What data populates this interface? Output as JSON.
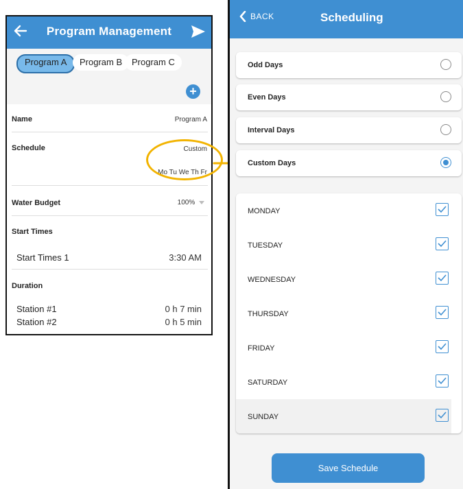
{
  "left": {
    "title": "Program Management",
    "tabs": [
      "Program A",
      "Program B",
      "Program C"
    ],
    "name_label": "Name",
    "name_value": "Program A",
    "schedule_label": "Schedule",
    "schedule_type": "Custom",
    "schedule_days": "Mo Tu We Th Fr",
    "water_budget_label": "Water Budget",
    "water_budget_value": "100%",
    "start_times_label": "Start Times",
    "start_time_1_label": "Start Times 1",
    "start_time_1_value": "3:30 AM",
    "duration_label": "Duration",
    "stations": [
      {
        "label": "Station #1",
        "value": "0 h 7 min"
      },
      {
        "label": "Station #2",
        "value": "0 h 5 min"
      }
    ]
  },
  "right": {
    "back_label": "BACK",
    "title": "Scheduling",
    "options": [
      {
        "label": "Odd Days",
        "selected": false
      },
      {
        "label": "Even Days",
        "selected": false
      },
      {
        "label": "Interval Days",
        "selected": false
      },
      {
        "label": "Custom Days",
        "selected": true
      }
    ],
    "days": [
      {
        "label": "MONDAY",
        "checked": true
      },
      {
        "label": "TUESDAY",
        "checked": true
      },
      {
        "label": "WEDNESDAY",
        "checked": true
      },
      {
        "label": "THURSDAY",
        "checked": true
      },
      {
        "label": "FRIDAY",
        "checked": true
      },
      {
        "label": "SATURDAY",
        "checked": true
      },
      {
        "label": "SUNDAY",
        "checked": true
      }
    ],
    "save_label": "Save Schedule"
  },
  "colors": {
    "header_blue": "#3f8fd2",
    "annotation_yellow": "#f2b300",
    "active_tab": "#78b9ea"
  },
  "icons": {
    "back_arrow": "arrow-left-icon",
    "send": "send-icon",
    "add": "plus-circle-icon",
    "dropdown": "caret-down-icon",
    "chevron_back": "chevron-left-icon"
  }
}
